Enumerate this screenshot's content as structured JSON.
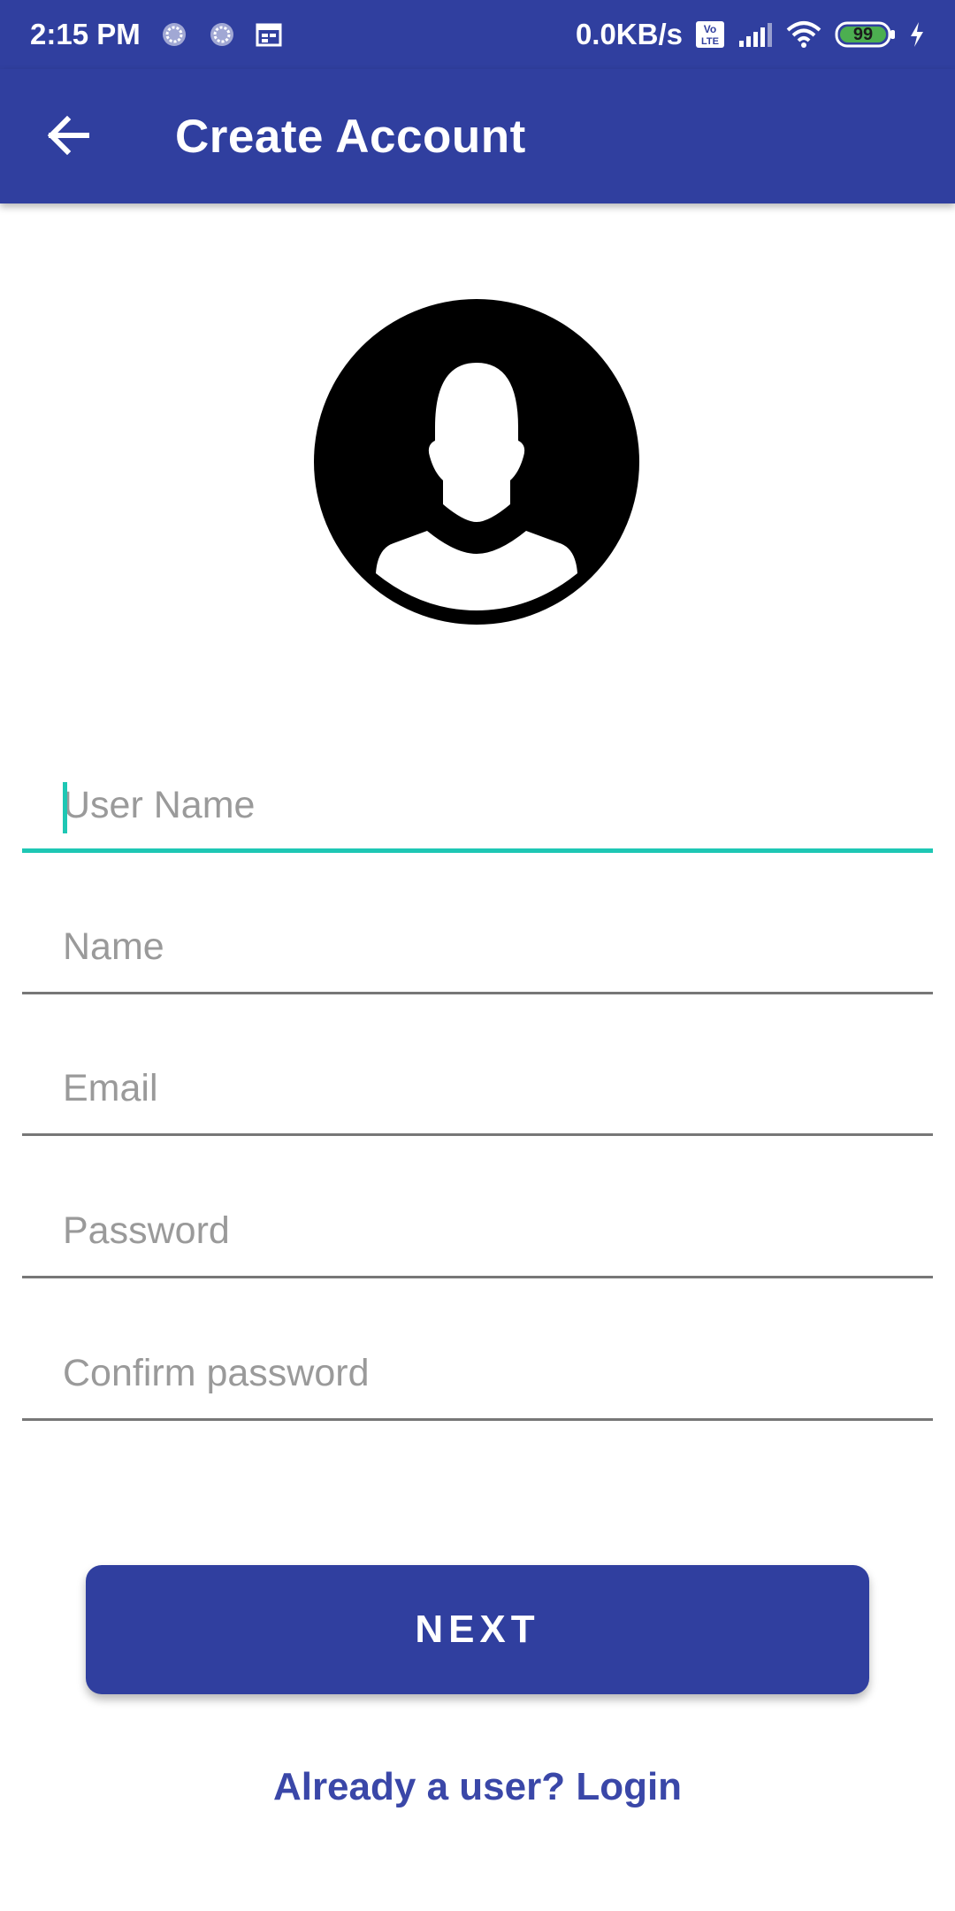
{
  "status_bar": {
    "time": "2:15 PM",
    "network_speed": "0.0KB/s",
    "volte_icon_label": "Vo LTE",
    "battery_level": "99",
    "icons": [
      "sync-circle-icon",
      "sync-circle-icon",
      "calendar-icon",
      "volte-icon",
      "signal-icon",
      "wifi-icon",
      "battery-icon",
      "charging-icon"
    ],
    "color": "#303f9f"
  },
  "app_bar": {
    "title": "Create Account",
    "back_icon": "arrow-back-icon",
    "color": "#303f9f"
  },
  "avatar": {
    "icon": "account-circle-icon"
  },
  "form": {
    "fields": [
      {
        "placeholder": "User Name",
        "value": "",
        "focused": true
      },
      {
        "placeholder": "Name",
        "value": ""
      },
      {
        "placeholder": "Email",
        "value": ""
      },
      {
        "placeholder": "Password",
        "value": ""
      },
      {
        "placeholder": "Confirm password",
        "value": ""
      }
    ],
    "focus_color": "#1ec7b4"
  },
  "actions": {
    "next_label": "NEXT",
    "login_link": "Already a user? Login",
    "accent": "#303f9f"
  }
}
